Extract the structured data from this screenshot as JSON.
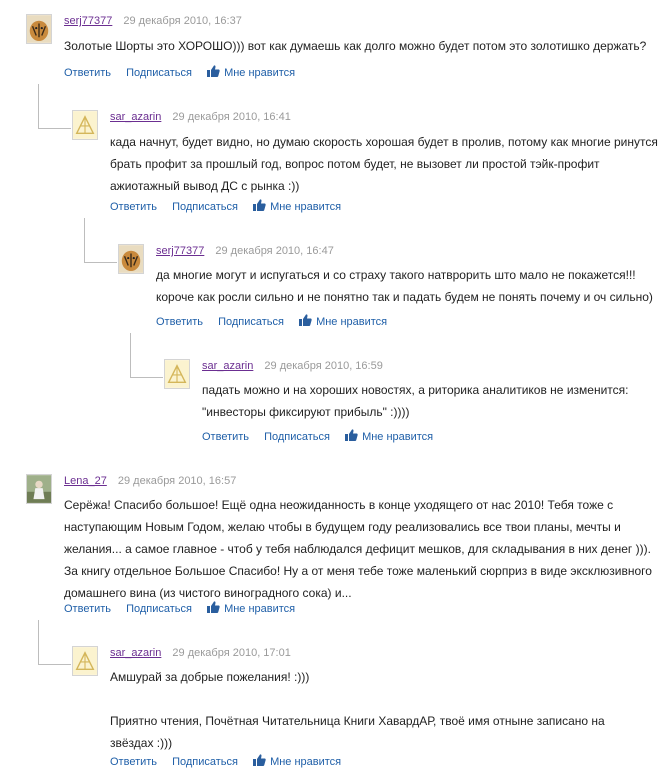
{
  "actions": {
    "reply": "Ответить",
    "subscribe": "Подписаться",
    "like": "Мне нравится"
  },
  "comments": [
    {
      "user": "serj77377",
      "date": "29 декабря 2010, 16:37",
      "lines": [
        "Золотые Шорты это ХОРОШО))) вот как думаешь как долго можно будет потом это золотишко держать?"
      ]
    },
    {
      "user": "sar_azarin",
      "date": "29 декабря 2010, 16:41",
      "lines": [
        "када начнут, будет видно, но думаю скорость хорошая будет в пролив, потому как многие ринутся",
        "брать профит за прошлый год, вопрос потом будет, не вызовет ли простой тэйк-профит",
        "ажиотажный вывод ДС с рынка :))"
      ]
    },
    {
      "user": "serj77377",
      "date": "29 декабря 2010, 16:47",
      "lines": [
        "да многие могут и испугаться и со страху такого натврорить што мало не покажется!!!",
        "короче как росли сильно и не понятно так и падать будем не понять почему и оч сильно)"
      ]
    },
    {
      "user": "sar_azarin",
      "date": "29 декабря 2010, 16:59",
      "lines": [
        "падать можно и на хороших новостях, а риторика аналитиков не изменится:",
        "\"инвесторы фиксируют прибыль\" :))))"
      ]
    },
    {
      "user": "Lena_27",
      "date": "29 декабря 2010, 16:57",
      "lines": [
        "Серёжа! Спасибо большое! Ещё одна неожиданность в конце уходящего от нас 2010! Тебя тоже с",
        "наступающим Новым Годом, желаю чтобы в будущем году реализовались все твои планы, мечты и",
        "желания... а самое главное - чтоб у тебя наблюдался дефицит мешков, для складывания в них денег ))).",
        "За книгу отдельное Большое Спасибо! Ну а от меня тебе тоже маленький сюрприз в виде эксклюзивного",
        "домашнего вина (из чистого виноградного сока) и..."
      ]
    },
    {
      "user": "sar_azarin",
      "date": "29 декабря 2010, 17:01",
      "lines": [
        "Амшурай за добрые пожелания! :)))",
        "",
        "Приятно чтения, Почётная Читательница Книги ХавардАР, твоё имя отныне записано на",
        "звёздах :)))"
      ]
    }
  ]
}
